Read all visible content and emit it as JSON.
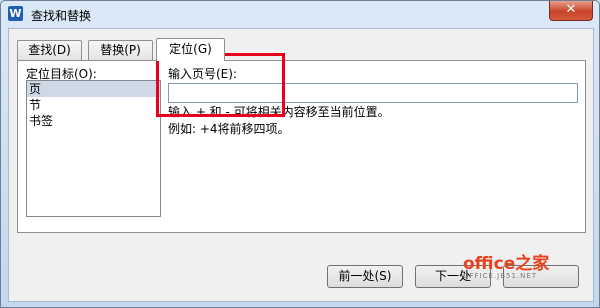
{
  "window": {
    "title": "查找和替换",
    "app_icon_letter": "W",
    "close_symbol": "✕"
  },
  "tabs": [
    {
      "label": "查找(D)"
    },
    {
      "label": "替换(P)"
    },
    {
      "label": "定位(G)",
      "active": true
    }
  ],
  "goto": {
    "target_label": "定位目标(O):",
    "targets": [
      "页",
      "节",
      "书签"
    ],
    "selected_target": "页",
    "page_number_label": "输入页号(E):",
    "page_number_value": "",
    "hint_line1": "输入 + 和 - 可将相关内容移至当前位置。",
    "hint_line2": "例如: +4将前移四项。"
  },
  "buttons": {
    "previous": "前一处(S)",
    "next": "下一处"
  },
  "watermark": {
    "main": "office之家",
    "sub": "OFFICE.JB51.NET"
  },
  "colors": {
    "highlight_box": "#e8001c",
    "close_button": "#c7442a",
    "selection": "#cfd8e6"
  }
}
